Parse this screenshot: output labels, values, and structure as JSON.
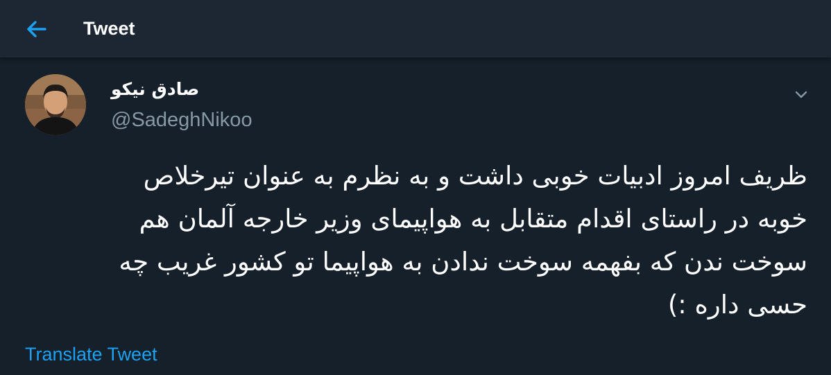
{
  "header": {
    "back_icon": "arrow-left-icon",
    "title": "Tweet"
  },
  "tweet": {
    "author": {
      "display_name": "صادق نیکو",
      "handle": "@SadeghNikoo",
      "avatar_icon": "user-photo-avatar"
    },
    "menu_icon": "chevron-down-icon",
    "text": "ظریف امروز ادبیات خوبی داشت و به نظرم به عنوان تیرخلاص\nخوبه در راستای اقدام متقابل به هواپیمای وزیر خارجه آلمان هم\nسوخت ندن که بفهمه سوخت ندادن به هواپیما تو کشور غریب چه\nحسی داره :)",
    "translate_label": "Translate Tweet"
  },
  "colors": {
    "background": "#15202b",
    "header_background": "#1c2733",
    "accent": "#1da1f2",
    "secondary_text": "#8899a6",
    "primary_text": "#ffffff"
  }
}
